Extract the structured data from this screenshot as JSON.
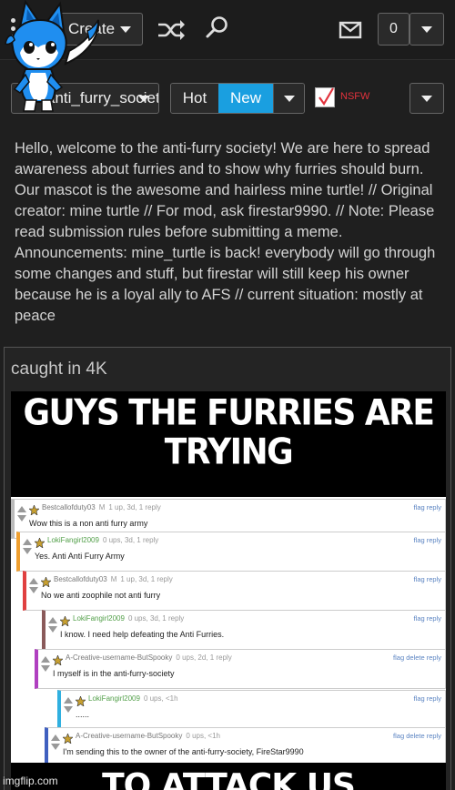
{
  "topbar": {
    "create_label": "Create",
    "notification_count": "0"
  },
  "filters": {
    "stream_name": "anti_furry_society",
    "sort_hot": "Hot",
    "sort_new": "New",
    "nsfw_label": "NSFW",
    "nsfw_checked": true
  },
  "stream": {
    "description": "Hello, welcome to the anti-furry society! We are here to spread awareness about furries and to show why furries should burn. Our mascot is the awesome and hairless mine turtle! // Original creator: mine turtle // For mod, ask firestar9990. // Note: Please read submission rules before submitting a meme. Announcements: mine_turtle is back! everybody will go through some changes and stuff, but firestar will still keep his owner because he is a loyal ally to AFS // current situation: mostly at peace"
  },
  "post": {
    "title": "caught in 4K",
    "meme": {
      "top_caption": "GUYS THE FURRIES ARE TRYING",
      "bottom_caption": "TO ATTACK US"
    },
    "comments": [
      {
        "user": "Bestcallofduty03",
        "badge": "M",
        "meta": "1 up, 3d, 1 reply",
        "text": "Wow this is a non anti furry army",
        "actions": "flag reply",
        "accent": "#bbbbbb"
      },
      {
        "user": "LokiFangirl2009",
        "badge": "",
        "meta": "0 ups, 3d, 1 reply",
        "text": "Yes. Anti Anti Furry Army",
        "actions": "flag reply",
        "accent": "#f0a030"
      },
      {
        "user": "Bestcallofduty03",
        "badge": "M",
        "meta": "1 up, 3d, 1 reply",
        "text": "No we anti zoophile not anti furry",
        "actions": "flag reply",
        "accent": "#e04040"
      },
      {
        "user": "LokiFangirl2009",
        "badge": "",
        "meta": "0 ups, 3d, 1 reply",
        "text": "I know. I need help defeating the Anti Furries.",
        "actions": "flag reply",
        "accent": "#8a5a5a"
      },
      {
        "user": "A-Creative-username-ButSpooky",
        "badge": "",
        "meta": "0 ups, 2d, 1 reply",
        "text": "I myself is in the anti-furry-society",
        "actions": "flag delete reply",
        "accent": "#b040c0"
      },
      {
        "user": "LokiFangirl2009",
        "badge": "",
        "meta": "0 ups, <1h",
        "text": "......",
        "actions": "flag reply",
        "accent": "#30b0e0"
      },
      {
        "user": "A-Creative-username-ButSpooky",
        "badge": "",
        "meta": "0 ups, <1h",
        "text": "I'm sending this to the owner of the anti-furry-society, FireStar9990",
        "actions": "flag delete reply",
        "accent": "#4060c0"
      }
    ]
  },
  "watermark": "imgflip.com",
  "colors": {
    "background": "#1f1f1f",
    "accent_blue": "#1a9fe0",
    "nsfw_red": "#e2323c",
    "mascot_blue": "#1f8ef0"
  },
  "icons": [
    "menu-dots-icon",
    "shuffle-icon",
    "search-icon",
    "mail-icon",
    "chevron-down-icon",
    "checkmark-icon"
  ]
}
